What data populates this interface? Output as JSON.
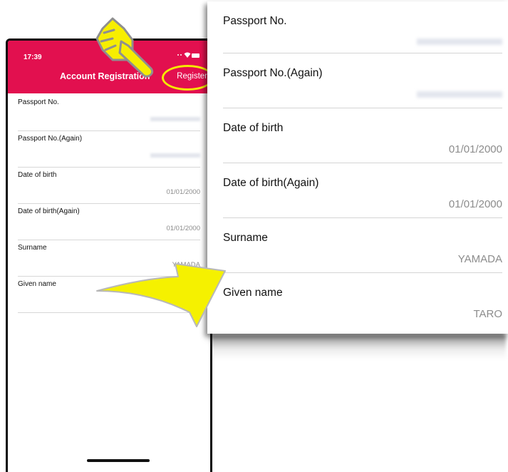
{
  "status_bar": {
    "time": "17:39"
  },
  "nav": {
    "title": "Account Registration",
    "register_label": "Register"
  },
  "phone_form": {
    "rows": [
      {
        "label": "Passport No.",
        "value": ""
      },
      {
        "label": "Passport No.(Again)",
        "value": ""
      },
      {
        "label": "Date of birth",
        "value": "01/01/2000"
      },
      {
        "label": "Date of birth(Again)",
        "value": "01/01/2000"
      },
      {
        "label": "Surname",
        "value": "YAMADA"
      },
      {
        "label": "Given name",
        "value": ""
      }
    ]
  },
  "zoom_form": {
    "rows": [
      {
        "label": "Passport No.",
        "value": ""
      },
      {
        "label": "Passport No.(Again)",
        "value": ""
      },
      {
        "label": "Date of birth",
        "value": "01/01/2000"
      },
      {
        "label": "Date of birth(Again)",
        "value": "01/01/2000"
      },
      {
        "label": "Surname",
        "value": "YAMADA"
      },
      {
        "label": "Given name",
        "value": "TARO"
      }
    ]
  },
  "colors": {
    "header": "#e2104f",
    "highlight": "#f5e900",
    "value_text": "#8c8c8c"
  },
  "icons": [
    "wifi-icon",
    "battery-icon",
    "pointing-hand-icon",
    "arrow-icon"
  ]
}
